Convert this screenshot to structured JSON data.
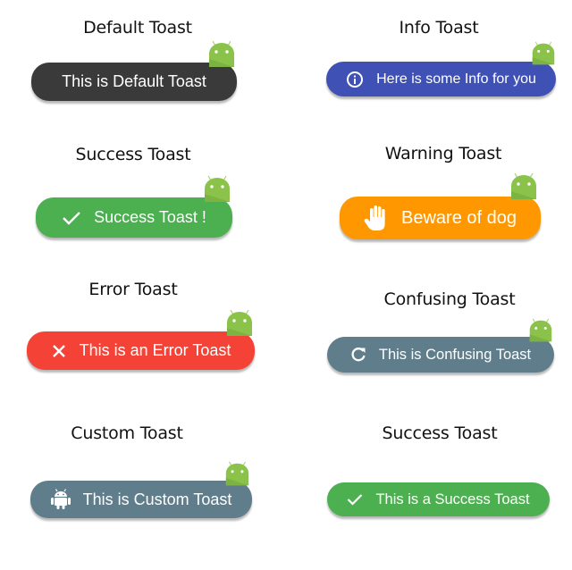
{
  "toasts": [
    {
      "id": "default",
      "title": "Default Toast",
      "message": "This is Default Toast",
      "color": "#3a3a3a",
      "icon": "none",
      "badge": true
    },
    {
      "id": "info",
      "title": "Info Toast",
      "message": "Here is some Info for you",
      "color": "#3f51b5",
      "icon": "info-icon",
      "badge": true
    },
    {
      "id": "success",
      "title": "Success Toast",
      "message": "Success Toast !",
      "color": "#4caf50",
      "icon": "check-icon",
      "badge": true
    },
    {
      "id": "warning",
      "title": "Warning Toast",
      "message": "Beware of dog",
      "color": "#ff9800",
      "icon": "hand-icon",
      "badge": true
    },
    {
      "id": "error",
      "title": "Error Toast",
      "message": "This is an Error Toast",
      "color": "#f44336",
      "icon": "close-icon",
      "badge": true
    },
    {
      "id": "confusing",
      "title": "Confusing Toast",
      "message": "This is Confusing Toast",
      "color": "#607d8b",
      "icon": "refresh-icon",
      "badge": true
    },
    {
      "id": "custom",
      "title": "Custom Toast",
      "message": "This is Custom Toast",
      "color": "#607d8b",
      "icon": "android-icon",
      "badge": true
    },
    {
      "id": "success2",
      "title": "Success Toast",
      "message": "This is a Success Toast",
      "color": "#4caf50",
      "icon": "check-icon",
      "badge": false
    }
  ],
  "badge_color": "#8bc34a"
}
